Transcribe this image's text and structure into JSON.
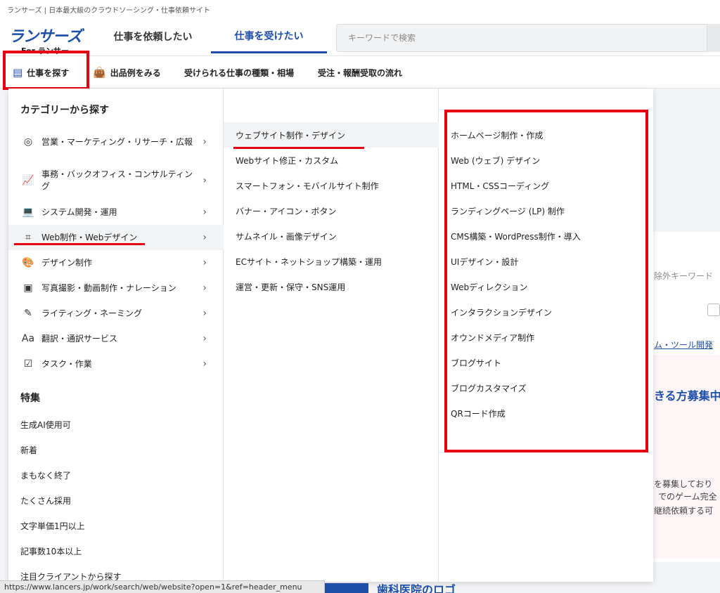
{
  "tagline": "ランサーズ | 日本最大級のクラウドソーシング・仕事依頼サイト",
  "header": {
    "logo": "ランサーズ",
    "logo_sub": "For ランサー",
    "tab_client": "仕事を依頼したい",
    "tab_worker": "仕事を受けたい",
    "search_placeholder": "キーワードで検索"
  },
  "subnav": {
    "find": "仕事を探す",
    "examples": "出品例をみる",
    "types": "受けられる仕事の種類・相場",
    "flow": "受注・報酬受取の流れ"
  },
  "menu": {
    "category_title": "カテゴリーから探す",
    "categories": [
      {
        "label": "営業・マーケティング・リサーチ・広報",
        "icon": "target-icon"
      },
      {
        "label": "事務・バックオフィス・コンサルティング",
        "icon": "chart-icon"
      },
      {
        "label": "システム開発・運用",
        "icon": "laptop-icon"
      },
      {
        "label": "Web制作・Webデザイン",
        "icon": "frame-icon"
      },
      {
        "label": "デザイン制作",
        "icon": "palette-icon"
      },
      {
        "label": "写真撮影・動画制作・ナレーション",
        "icon": "media-icon"
      },
      {
        "label": "ライティング・ネーミング",
        "icon": "pen-icon"
      },
      {
        "label": "翻訳・通訳サービス",
        "icon": "text-icon"
      },
      {
        "label": "タスク・作業",
        "icon": "task-icon"
      }
    ],
    "feature_title": "特集",
    "features": [
      "生成AI使用可",
      "新着",
      "まもなく終了",
      "たくさん採用",
      "文字単価1円以上",
      "記事数10本以上",
      "注目クライアントから探す"
    ],
    "subcategories": [
      "ウェブサイト制作・デザイン",
      "Webサイト修正・カスタム",
      "スマートフォン・モバイルサイト制作",
      "バナー・アイコン・ボタン",
      "サムネイル・画像デザイン",
      "ECサイト・ネットショップ構築・運用",
      "運営・更新・保守・SNS運用"
    ],
    "leaves": [
      "ホームページ制作・作成",
      "Web (ウェブ) デザイン",
      "HTML・CSSコーディング",
      "ランディングページ (LP) 制作",
      "CMS構築・WordPress制作・導入",
      "UIデザイン・設計",
      "Webディレクション",
      "インタラクションデザイン",
      "オウンドメディア制作",
      "ブログサイト",
      "ブログカスタマイズ",
      "QRコード作成"
    ]
  },
  "background": {
    "exclude_keyword": "除外キーワード",
    "link": "ム・ツール開発",
    "heading": "きる方募集中",
    "text1": "を募集しており",
    "text2": "でのゲーム完全",
    "text3": "継続依頼する可",
    "bottom_heading": "歯科医院のロゴ"
  },
  "statusbar": "https://www.lancers.jp/work/search/web/website?open=1&ref=header_menu",
  "colors": {
    "brand": "#1d4fa8",
    "highlight": "#e60012"
  }
}
